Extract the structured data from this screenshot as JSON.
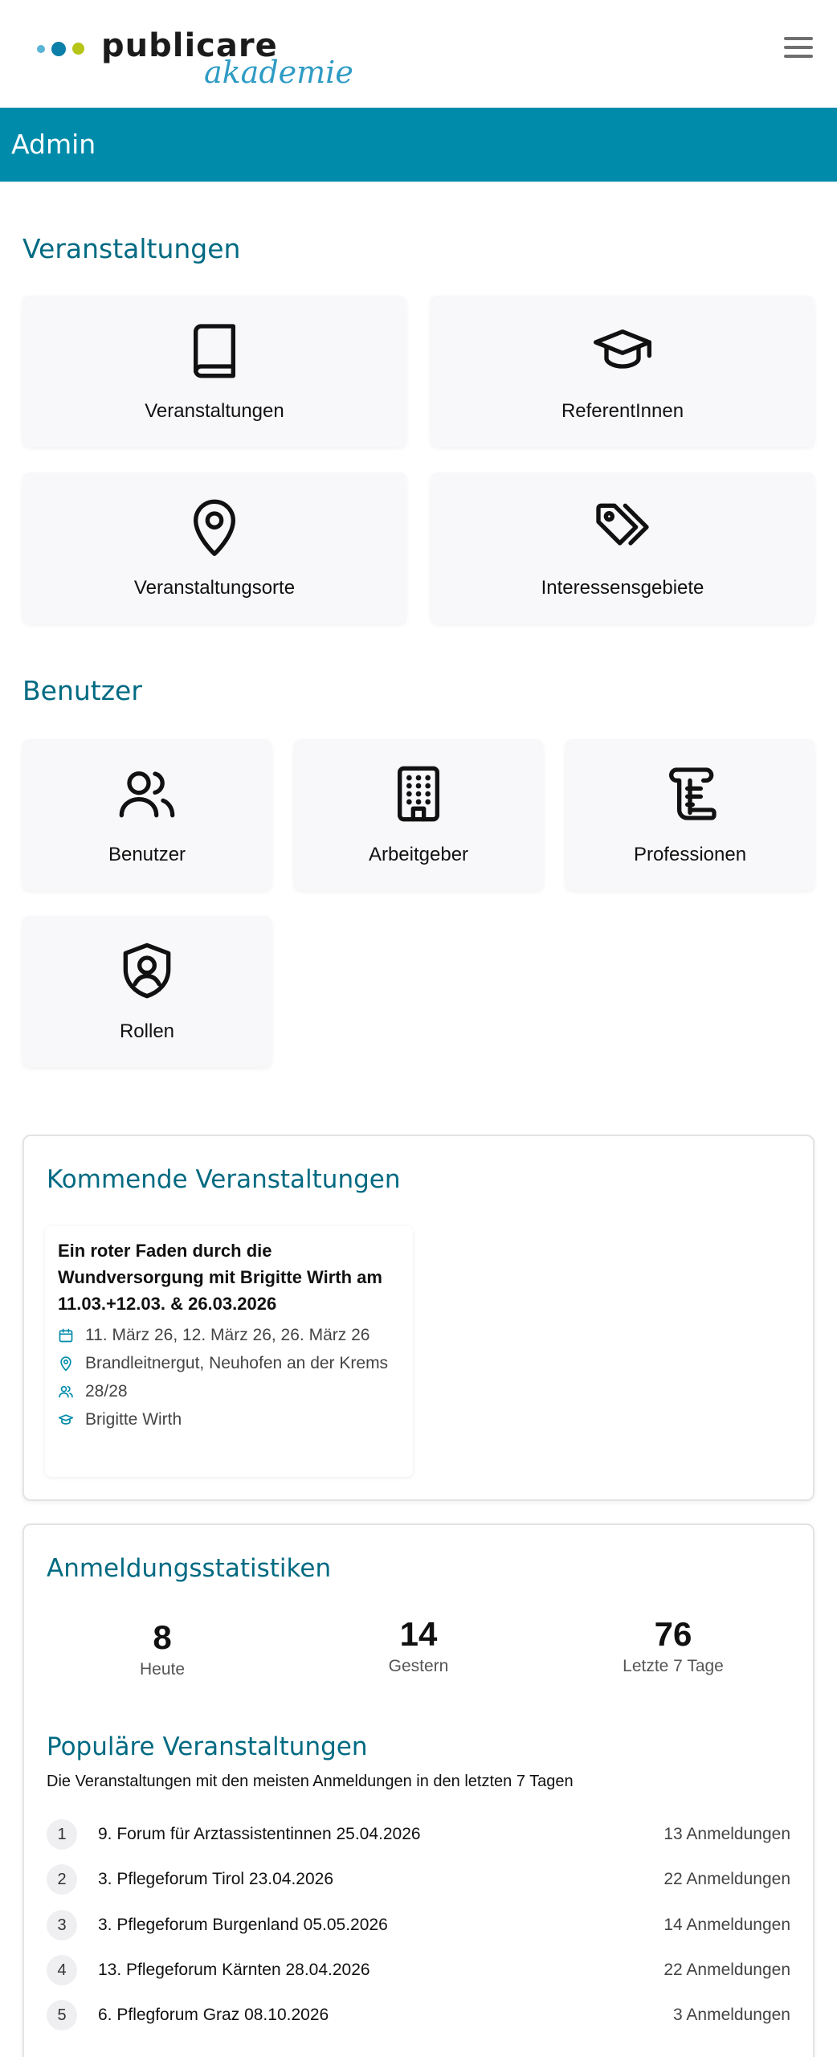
{
  "brand": {
    "name": "publicare",
    "subname": "akademie",
    "colors": {
      "dot_small": "#5ab4d6",
      "dot_mid": "#0a7fa8",
      "dot_green": "#b5c416",
      "subname": "#2e9bc4"
    }
  },
  "header": {
    "menu_icon": "hamburger-menu-icon"
  },
  "admin_bar": {
    "title": "Admin",
    "color": "#008bab"
  },
  "sections": {
    "veranstaltungen": {
      "title": "Veranstaltungen",
      "tiles": [
        {
          "label": "Veranstaltungen",
          "icon": "book-icon"
        },
        {
          "label": "ReferentInnen",
          "icon": "graduation-cap-icon"
        },
        {
          "label": "Veranstaltungsorte",
          "icon": "map-pin-icon"
        },
        {
          "label": "Interessensgebiete",
          "icon": "tags-icon"
        }
      ]
    },
    "benutzer": {
      "title": "Benutzer",
      "tiles": [
        {
          "label": "Benutzer",
          "icon": "users-icon"
        },
        {
          "label": "Arbeitgeber",
          "icon": "building-icon"
        },
        {
          "label": "Professionen",
          "icon": "scroll-icon"
        },
        {
          "label": "Rollen",
          "icon": "shield-user-icon"
        }
      ]
    }
  },
  "upcoming": {
    "title": "Kommende Veranstaltungen",
    "event": {
      "title": "Ein roter Faden durch die Wundversorgung mit Brigitte Wirth am 11.03.+12.03. & 26.03.2026",
      "dates": "11. März 26, 12. März 26, 26. März 26",
      "location": "Brandleitnergut, Neuhofen an der Krems",
      "capacity": "28/28",
      "speaker": "Brigitte Wirth"
    }
  },
  "stats": {
    "title": "Anmeldungsstatistiken",
    "items": [
      {
        "value": "8",
        "label": "Heute"
      },
      {
        "value": "14",
        "label": "Gestern"
      },
      {
        "value": "76",
        "label": "Letzte 7 Tage"
      }
    ]
  },
  "popular": {
    "title": "Populäre Veranstaltungen",
    "subtitle": "Die Veranstaltungen mit den meisten Anmeldungen in den letzten 7 Tagen",
    "items": [
      {
        "rank": "1",
        "name": "9. Forum für Arztassistentinnen 25.04.2026",
        "count": "13 Anmeldungen"
      },
      {
        "rank": "2",
        "name": "3. Pflegeforum Tirol 23.04.2026",
        "count": "22 Anmeldungen"
      },
      {
        "rank": "3",
        "name": "3. Pflegeforum Burgenland 05.05.2026",
        "count": "14 Anmeldungen"
      },
      {
        "rank": "4",
        "name": "13. Pflegeforum Kärnten 28.04.2026",
        "count": "22 Anmeldungen"
      },
      {
        "rank": "5",
        "name": "6. Pflegforum Graz 08.10.2026",
        "count": "3 Anmeldungen"
      }
    ]
  }
}
